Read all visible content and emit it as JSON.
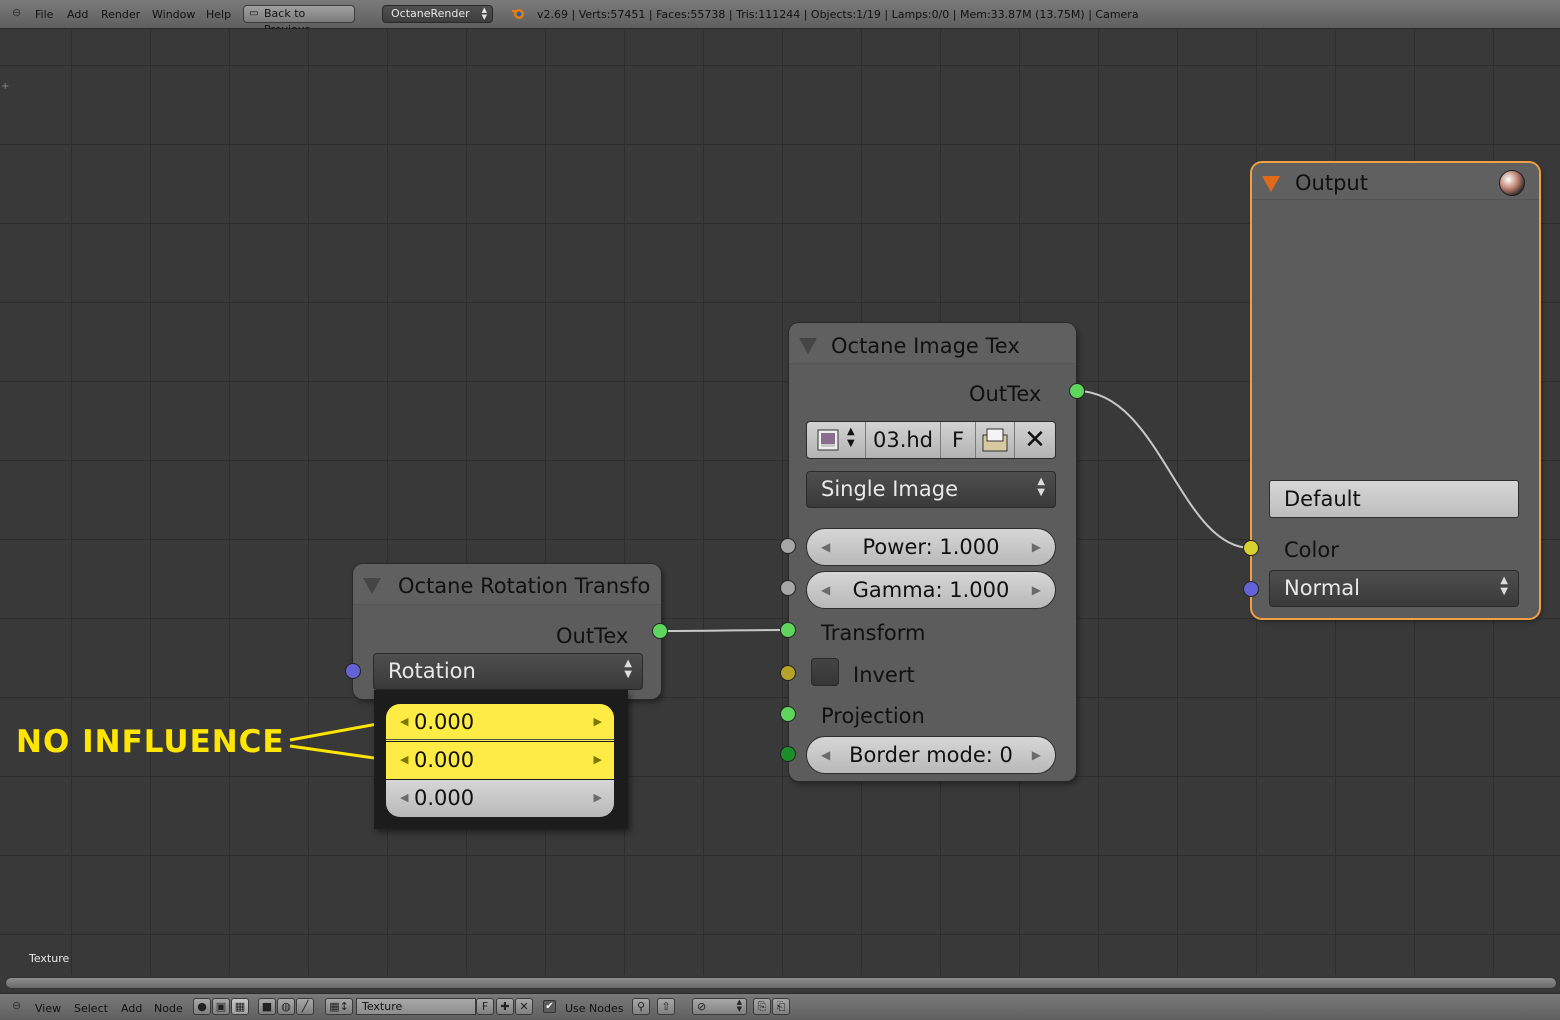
{
  "topbar": {
    "menus": [
      "File",
      "Add",
      "Render",
      "Window",
      "Help"
    ],
    "back_button": "Back to Previous",
    "render_engine": "OctaneRender",
    "stats": "v2.69 | Verts:57451 | Faces:55738 | Tris:111244 | Objects:1/19 | Lamps:0/0 | Mem:33.87M (13.75M) | Camera"
  },
  "canvas": {
    "label": "Texture"
  },
  "nodes": {
    "rotation": {
      "title": "Octane Rotation Transfo",
      "output": "OutTex",
      "mode": "Rotation",
      "values": [
        "0.000",
        "0.000",
        "0.000"
      ]
    },
    "image_tex": {
      "title": "Octane Image Tex",
      "output": "OutTex",
      "file": "03.hd",
      "fake_user": "F",
      "image_type": "Single Image",
      "power": "Power: 1.000",
      "gamma": "Gamma: 1.000",
      "transform": "Transform",
      "invert": "Invert",
      "projection": "Projection",
      "border_mode": "Border mode: 0"
    },
    "output": {
      "title": "Output",
      "default_button": "Default",
      "color_label": "Color",
      "normal_dropdown": "Normal"
    }
  },
  "annotation": {
    "text": "NO INFLUENCE"
  },
  "bottombar": {
    "menus": [
      "View",
      "Select",
      "Add",
      "Node"
    ],
    "texture_name": "Texture",
    "fake_user": "F",
    "use_nodes": "Use Nodes"
  },
  "colors": {
    "socket_green": "#5ed65e",
    "socket_grey": "#a6a6a6",
    "socket_yellow_dark": "#b5a229",
    "socket_yellow": "#d8d02c",
    "socket_blue": "#6363d6",
    "socket_dark_green": "#1a8f2a",
    "highlight_yellow": "#ffeb45",
    "selection_orange": "#f0a040"
  }
}
